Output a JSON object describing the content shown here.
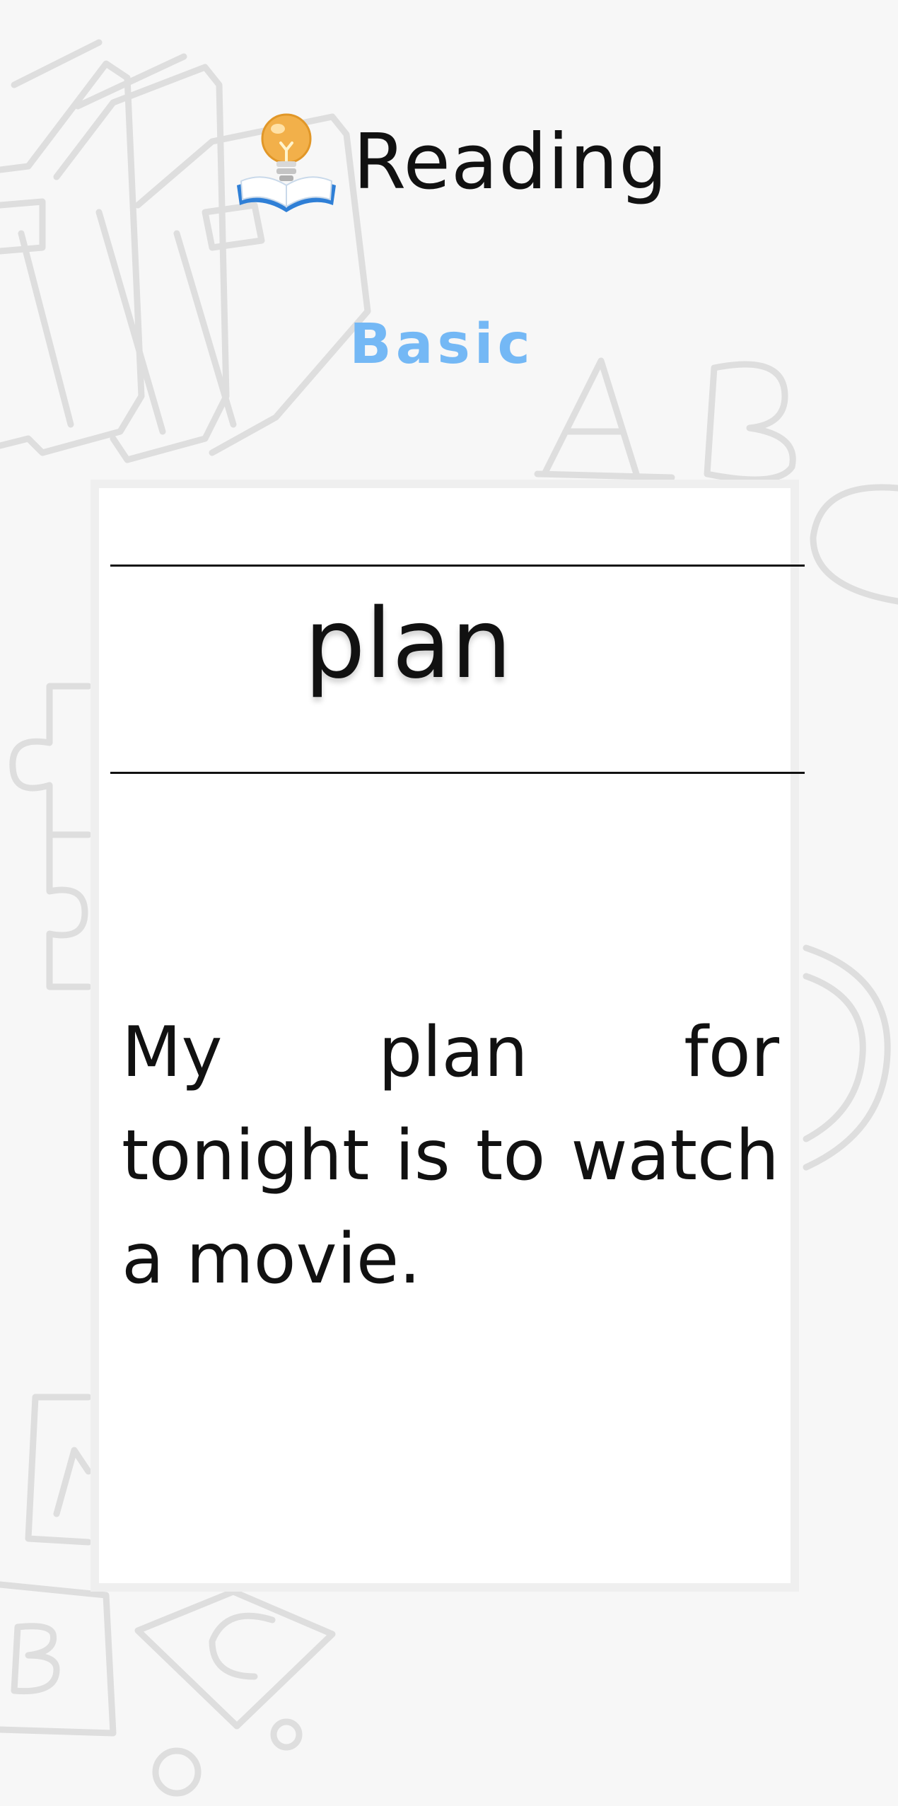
{
  "header": {
    "icon": "book-lightbulb-icon",
    "title": "Reading"
  },
  "level": {
    "label": "Basic",
    "color": "#74b8f5"
  },
  "card": {
    "word": "plan",
    "sentence": "My plan for tonight is to watch a movie."
  },
  "background": {
    "doodles": [
      "books-doodle",
      "letter-a-doodle",
      "letter-b-doodle",
      "puzzle-doodle",
      "ring-doodle",
      "letter-block-doodle"
    ],
    "doodle_color": "#dcdcdc"
  }
}
